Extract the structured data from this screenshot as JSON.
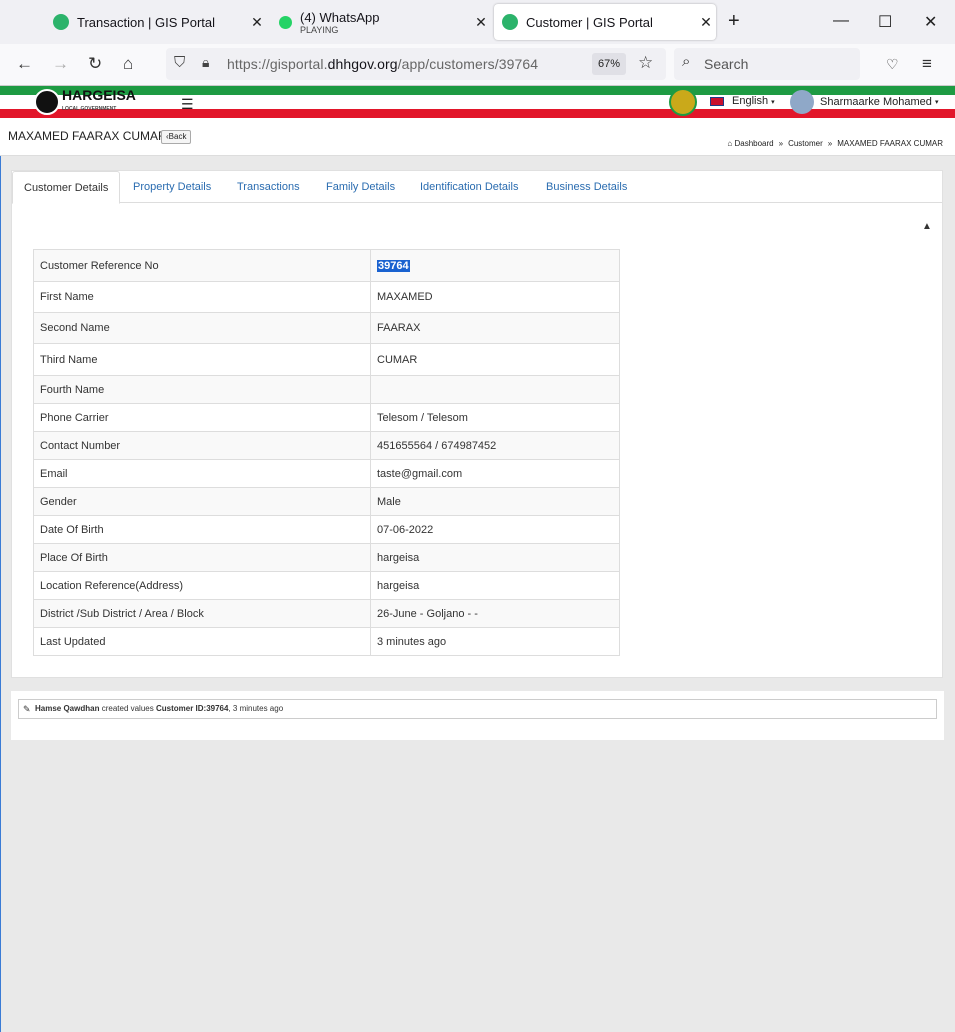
{
  "browser": {
    "tabs": [
      {
        "title": "Transaction | GIS Portal",
        "sub": "",
        "icon": "gis-portal-favicon"
      },
      {
        "title": "(4) WhatsApp",
        "sub": "PLAYING",
        "icon": "whatsapp-favicon"
      },
      {
        "title": "Customer | GIS Portal",
        "sub": "",
        "icon": "gis-portal-favicon"
      }
    ],
    "url_prefix": "https://gisportal.",
    "url_domain": "dhhgov.org",
    "url_path": "/app/customers/39764",
    "zoom": "67%",
    "search_placeholder": "Search"
  },
  "header": {
    "logo_text": "HARGEISA",
    "logo_sub": "LOCAL GOVERNMENT",
    "language": "English",
    "user": "Sharmaarke Mohamed"
  },
  "page": {
    "title": "MAXAMED FAARAX CUMAR",
    "back_label": "Back",
    "breadcrumbs": [
      "Dashboard",
      "Customer",
      "MAXAMED FAARAX CUMAR"
    ]
  },
  "tabs": [
    "Customer Details",
    "Property Details",
    "Transactions",
    "Family Details",
    "Identification Details",
    "Business Details"
  ],
  "details": [
    {
      "label": "Customer Reference No",
      "value": "39764"
    },
    {
      "label": "First Name",
      "value": "MAXAMED"
    },
    {
      "label": "Second Name",
      "value": "FAARAX"
    },
    {
      "label": "Third Name",
      "value": "CUMAR"
    },
    {
      "label": "Fourth Name",
      "value": ""
    },
    {
      "label": "Phone Carrier",
      "value": "Telesom / Telesom"
    },
    {
      "label": "Contact Number",
      "value": "451655564 / 674987452"
    },
    {
      "label": "Email",
      "value": "taste@gmail.com"
    },
    {
      "label": "Gender",
      "value": "Male"
    },
    {
      "label": "Date Of Birth",
      "value": "07-06-2022"
    },
    {
      "label": "Place Of Birth",
      "value": "hargeisa"
    },
    {
      "label": "Location Reference(Address)",
      "value": "hargeisa"
    },
    {
      "label": "District /Sub District / Area / Block",
      "value": "26-June - Goljano - -"
    },
    {
      "label": "Last Updated",
      "value": "3 minutes ago"
    }
  ],
  "activity": {
    "user": "Hamse Qawdhan",
    "action": "created values",
    "target": "Customer ID:39764",
    "time": ", 3 minutes ago"
  },
  "colors": {
    "accent": "#2a6cb0",
    "green": "#1e9b43",
    "red": "#e2162a",
    "highlight": "#1a62d0"
  }
}
